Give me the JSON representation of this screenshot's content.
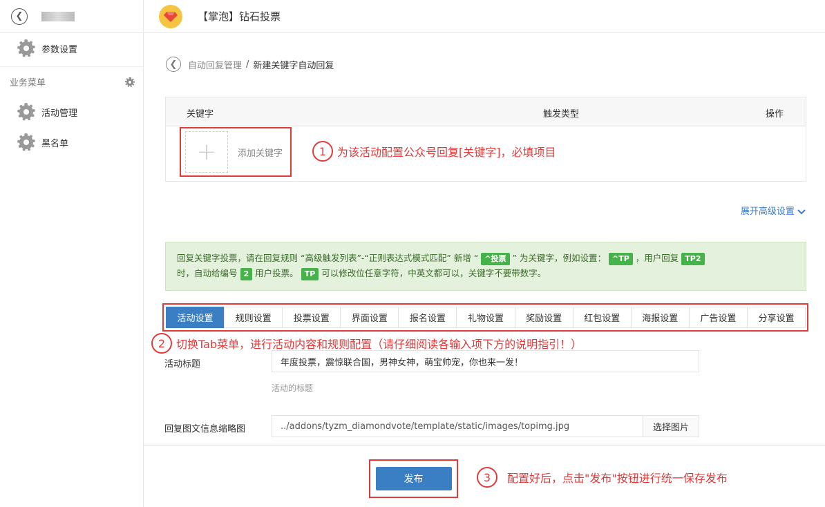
{
  "sidebar": {
    "items": [
      {
        "label": "参数设置"
      },
      {
        "label": "活动管理"
      },
      {
        "label": "黑名单"
      }
    ],
    "section_title": "业务菜单"
  },
  "header": {
    "title": "【掌泡】钻石投票"
  },
  "breadcrumb": {
    "parent": "自动回复管理",
    "separator": "/",
    "current": "新建关键字自动回复"
  },
  "keyword_table": {
    "columns": [
      "关键字",
      "触发类型",
      "操作"
    ],
    "add_label": "添加关键字",
    "add_symbol": "+"
  },
  "annotations": [
    {
      "num": "1",
      "text": "为该活动配置公众号回复[关键字]，必填项目"
    },
    {
      "num": "2",
      "text": "切换Tab菜单，进行活动内容和规则配置（请仔细阅读各输入项下方的说明指引！）"
    },
    {
      "num": "3",
      "text": "配置好后，点击\"发布\"按钮进行统一保存发布"
    }
  ],
  "expand_label": "展开高级设置",
  "tip": {
    "p1": "回复关键字投票，请在回复规则 “高级触发列表”-“正则表达式模式匹配” 新增 “",
    "tag1": "^投票",
    "p2": "” 为关键字，例如设置：",
    "tag2": "^TP",
    "p3": "，用户回复",
    "tag3": "TP2",
    "p4": "时，自动给编号",
    "tag4": "2",
    "p5": "用户投票。",
    "tag5": "TP",
    "p6": "可以修改位任意字符，中英文都可以，关键字不要带数字。"
  },
  "tabs": [
    {
      "label": "活动设置",
      "active": true
    },
    {
      "label": "规则设置"
    },
    {
      "label": "投票设置"
    },
    {
      "label": "界面设置"
    },
    {
      "label": "报名设置"
    },
    {
      "label": "礼物设置"
    },
    {
      "label": "奖励设置"
    },
    {
      "label": "红包设置"
    },
    {
      "label": "海报设置"
    },
    {
      "label": "广告设置"
    },
    {
      "label": "分享设置"
    }
  ],
  "form": {
    "title_label": "活动标题",
    "title_value": "年度投票，震惊联合国，男神女神，萌宝帅宠，你也来一发！",
    "title_help": "活动的标题",
    "thumb_label": "回复图文信息缩略图",
    "thumb_value": "../addons/tyzm_diamondvote/template/static/images/topimg.jpg",
    "thumb_button": "选择图片"
  },
  "publish_label": "发布",
  "colors": {
    "accent": "#3a7fc3",
    "annotation": "#e03a3a",
    "tip_bg": "#e3f1dd",
    "tag": "#45b349",
    "link": "#3a7bc8"
  }
}
